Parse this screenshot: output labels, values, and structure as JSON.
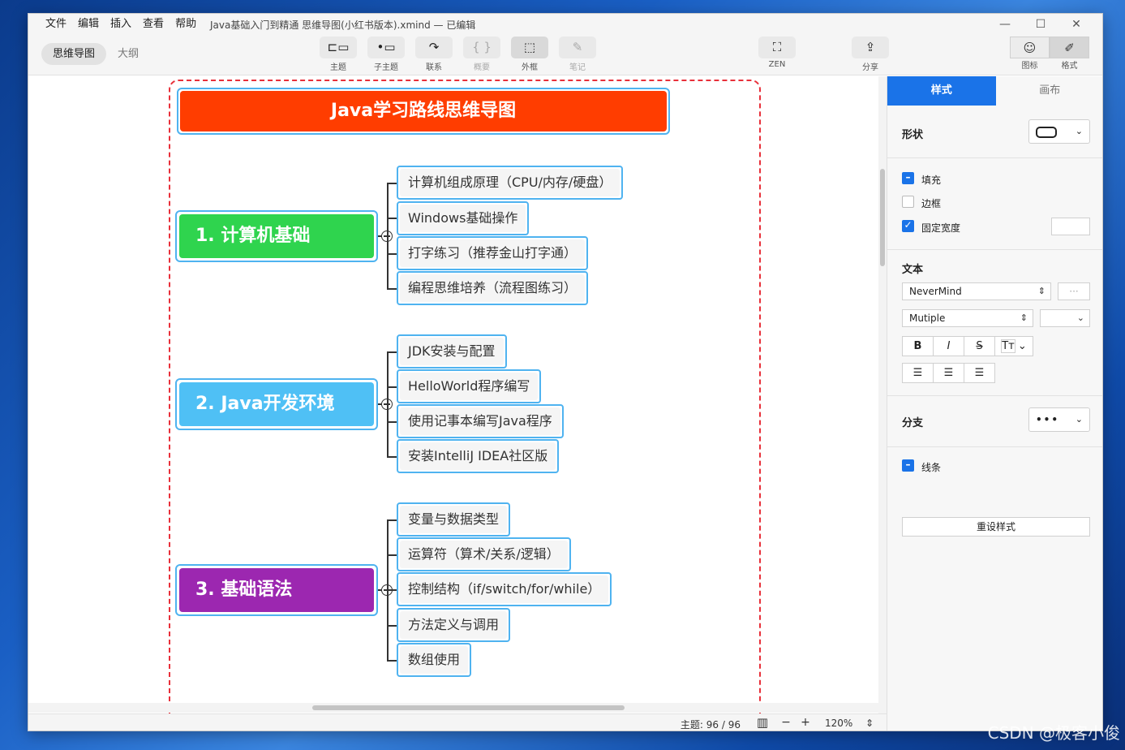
{
  "menu": [
    "文件",
    "编辑",
    "插入",
    "查看",
    "帮助"
  ],
  "doc_title": "Java基础入门到精通 思维导图(小红书版本).xmind — 已编辑",
  "window_controls": [
    "—",
    "☐",
    "✕"
  ],
  "view_toggle": {
    "mindmap": "思维导图",
    "outline": "大纲"
  },
  "toolbar": {
    "topic": "主题",
    "subtopic": "子主题",
    "relation": "联系",
    "summary": "概要",
    "boundary": "外框",
    "note": "笔记",
    "zen": "ZEN",
    "share": "分享",
    "icon": "图标",
    "format": "格式"
  },
  "mindmap": {
    "central": "Java学习路线思维导图",
    "branches": [
      {
        "title": "1. 计算机基础",
        "color": "#2fd44e",
        "children": [
          "计算机组成原理（CPU/内存/硬盘）",
          "Windows基础操作",
          "打字练习（推荐金山打字通）",
          "编程思维培养（流程图练习）"
        ]
      },
      {
        "title": "2. Java开发环境",
        "color": "#4fc0f5",
        "children": [
          "JDK安装与配置",
          "HelloWorld程序编写",
          "使用记事本编写Java程序",
          "安装IntelliJ IDEA社区版"
        ]
      },
      {
        "title": "3. 基础语法",
        "color": "#9c27b0",
        "children": [
          "变量与数据类型",
          "运算符（算术/关系/逻辑）",
          "控制结构（if/switch/for/while）",
          "方法定义与调用",
          "数组使用"
        ]
      }
    ]
  },
  "status": {
    "topic_count": "主题: 96 / 96",
    "zoom": "120%",
    "minus": "−",
    "plus": "+"
  },
  "panel": {
    "tab_style": "样式",
    "tab_canvas": "画布",
    "shape_label": "形状",
    "fill_label": "填充",
    "border_label": "边框",
    "fixed_width_label": "固定宽度",
    "text_label": "文本",
    "font_family": "NeverMind",
    "font_weight": "Mutiple",
    "bold": "B",
    "italic": "I",
    "strike": "S",
    "case": "Tт",
    "branch_label": "分支",
    "line_label": "线条",
    "reset": "重设样式"
  },
  "watermark": "CSDN @极客小俊"
}
